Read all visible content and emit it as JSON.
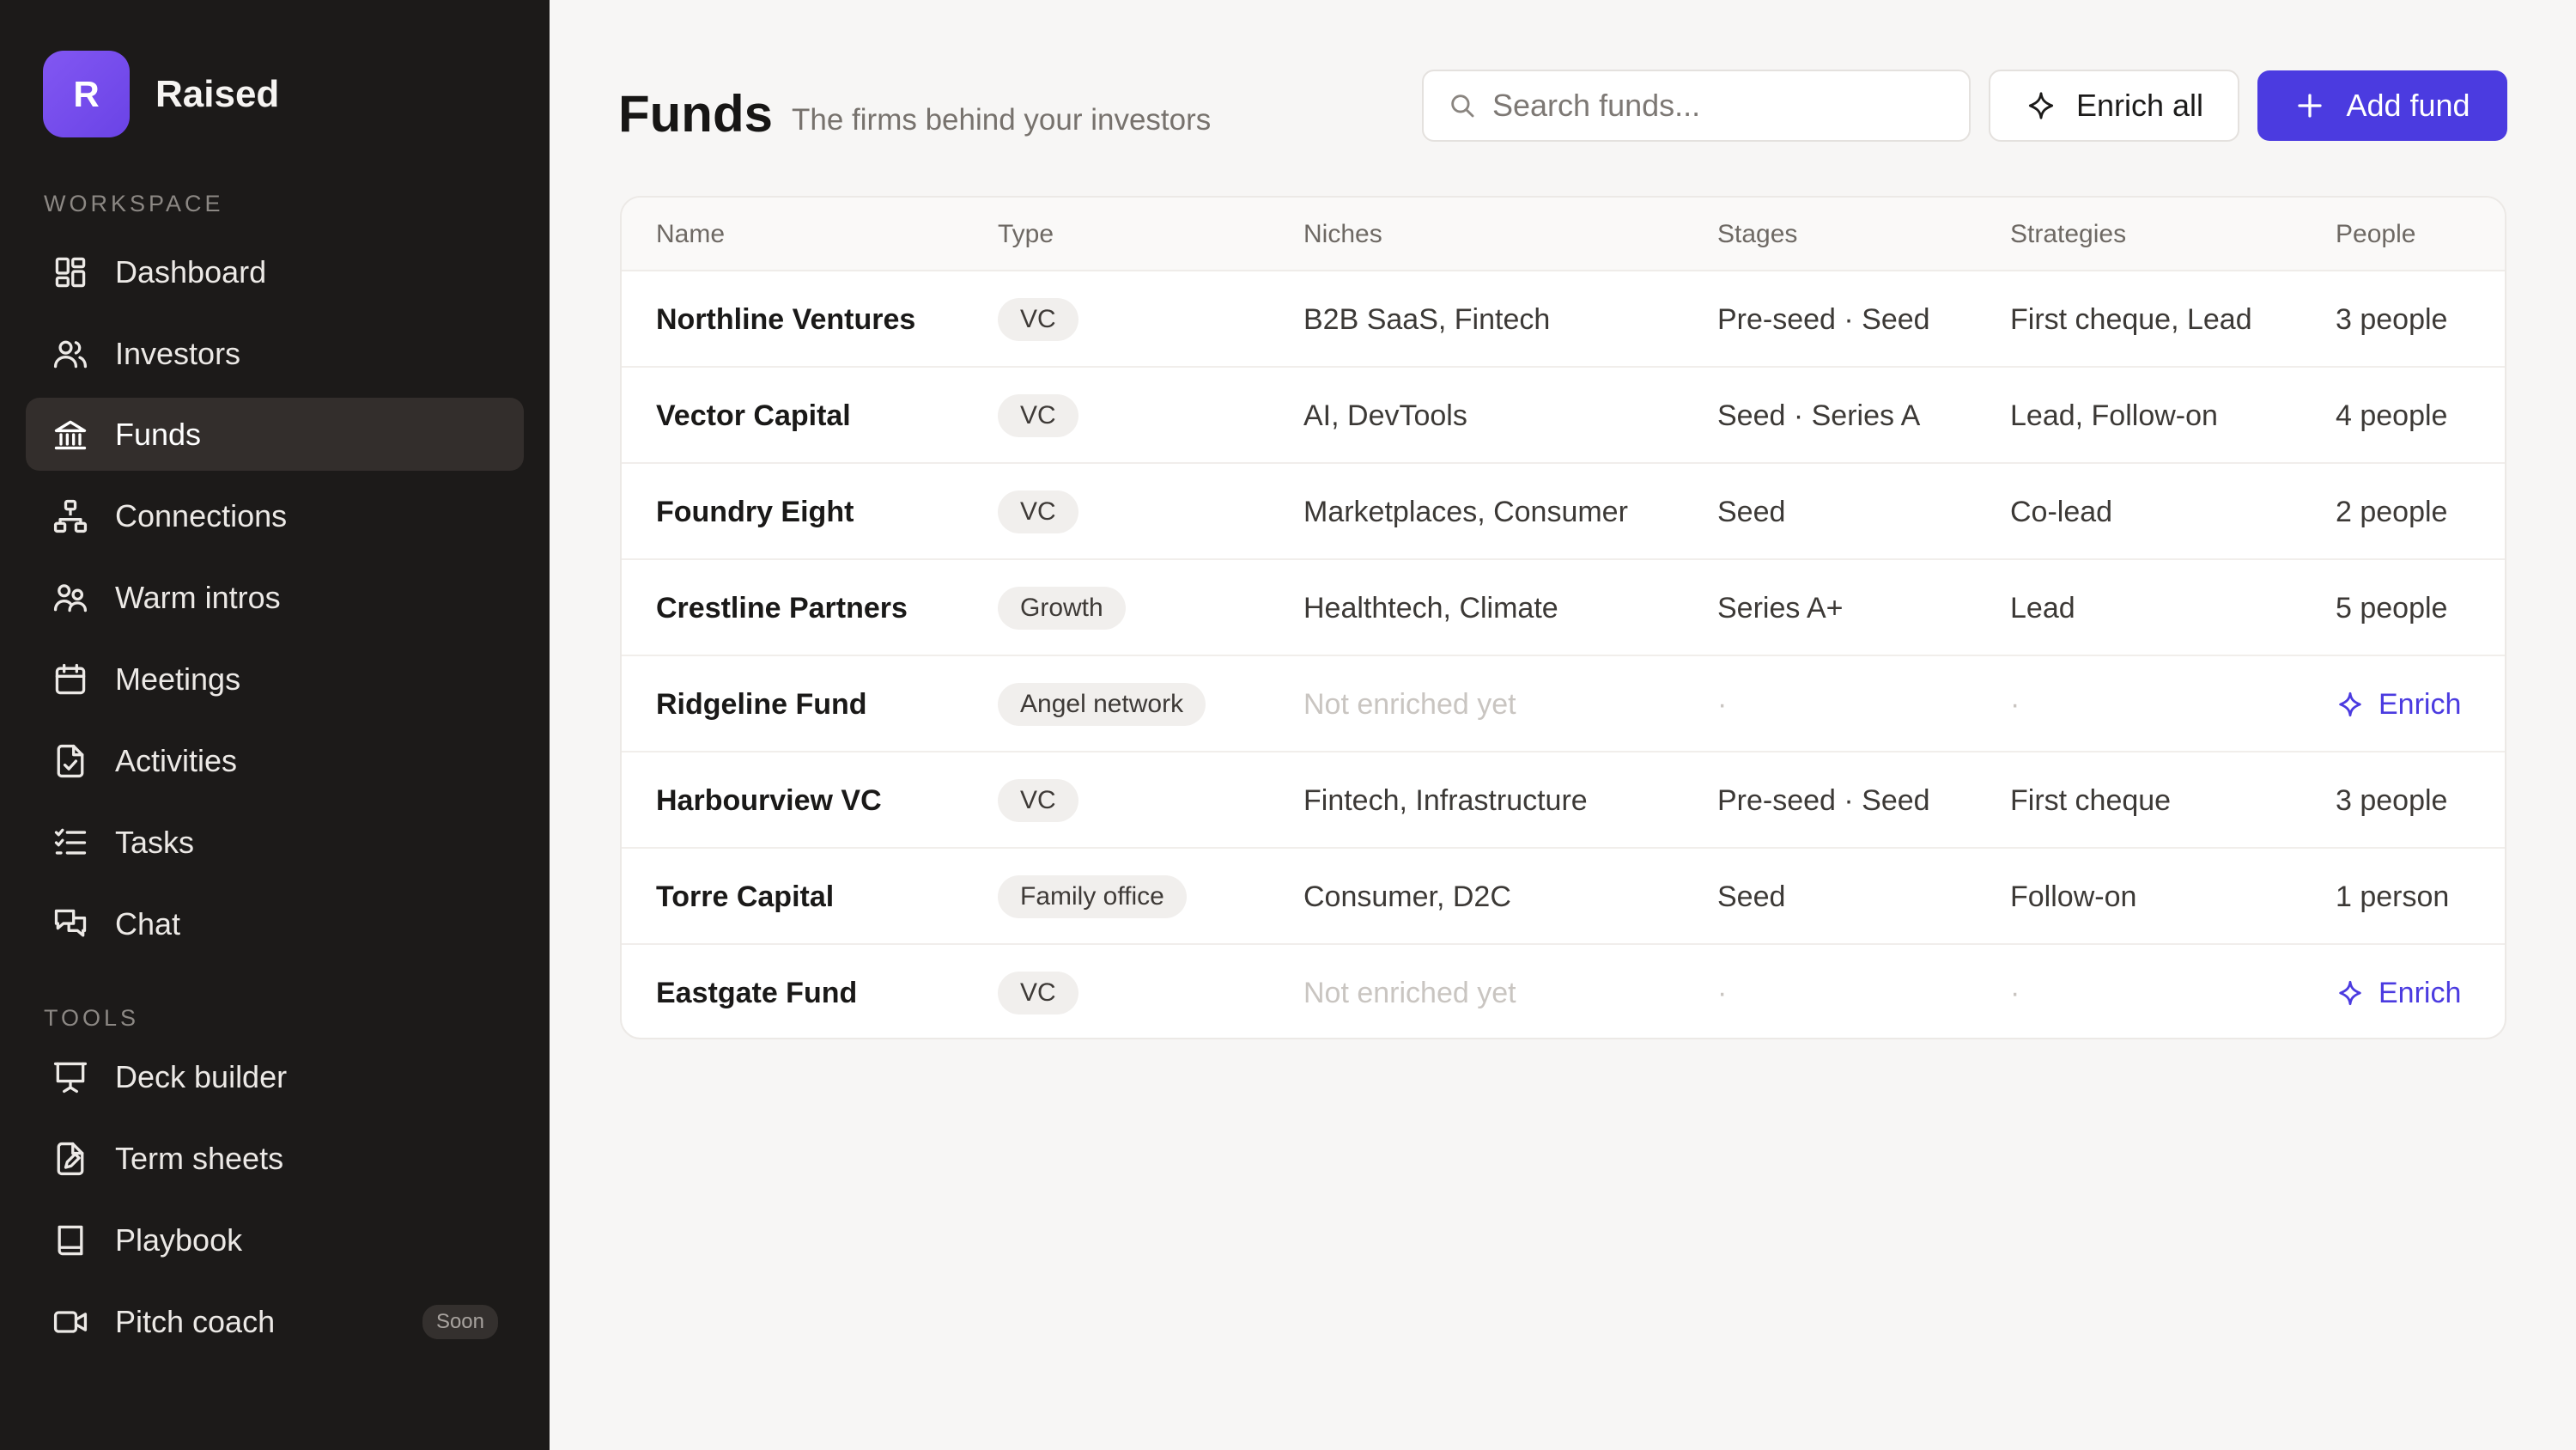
{
  "app": {
    "logo_letter": "R",
    "name": "Raised"
  },
  "sidebar": {
    "workspace_label": "WORKSPACE",
    "tools_label": "TOOLS",
    "workspace_items": [
      {
        "label": "Dashboard",
        "icon": "dashboard-icon",
        "active": false
      },
      {
        "label": "Investors",
        "icon": "users-icon",
        "active": false
      },
      {
        "label": "Funds",
        "icon": "bank-icon",
        "active": true
      },
      {
        "label": "Connections",
        "icon": "network-icon",
        "active": false
      },
      {
        "label": "Warm intros",
        "icon": "people-intro-icon",
        "active": false
      },
      {
        "label": "Meetings",
        "icon": "calendar-icon",
        "active": false
      },
      {
        "label": "Activities",
        "icon": "file-check-icon",
        "active": false
      },
      {
        "label": "Tasks",
        "icon": "checklist-icon",
        "active": false
      },
      {
        "label": "Chat",
        "icon": "chat-icon",
        "active": false
      }
    ],
    "tools_items": [
      {
        "label": "Deck builder",
        "icon": "presentation-icon"
      },
      {
        "label": "Term sheets",
        "icon": "document-edit-icon"
      },
      {
        "label": "Playbook",
        "icon": "book-icon"
      },
      {
        "label": "Pitch coach",
        "icon": "video-icon",
        "badge": "Soon"
      }
    ]
  },
  "header": {
    "title": "Funds",
    "subtitle": "The firms behind your investors",
    "search_placeholder": "Search funds...",
    "enrich_all_label": "Enrich all",
    "add_fund_label": "Add fund"
  },
  "table": {
    "columns": [
      "Name",
      "Type",
      "Niches",
      "Stages",
      "Strategies",
      "People"
    ],
    "rows": [
      {
        "name": "Northline Ventures",
        "type": "VC",
        "niches": "B2B SaaS, Fintech",
        "stages": "Pre-seed · Seed",
        "strategies": "First cheque, Lead",
        "people": "3 people",
        "enriched": true
      },
      {
        "name": "Vector Capital",
        "type": "VC",
        "niches": "AI, DevTools",
        "stages": "Seed · Series A",
        "strategies": "Lead, Follow-on",
        "people": "4 people",
        "enriched": true
      },
      {
        "name": "Foundry Eight",
        "type": "VC",
        "niches": "Marketplaces, Consumer",
        "stages": "Seed",
        "strategies": "Co-lead",
        "people": "2 people",
        "enriched": true
      },
      {
        "name": "Crestline Partners",
        "type": "Growth",
        "niches": "Healthtech, Climate",
        "stages": "Series A+",
        "strategies": "Lead",
        "people": "5 people",
        "enriched": true
      },
      {
        "name": "Ridgeline Fund",
        "type": "Angel network",
        "niches": "Not enriched yet",
        "stages": "·",
        "strategies": "·",
        "people": "Enrich",
        "enriched": false
      },
      {
        "name": "Harbourview VC",
        "type": "VC",
        "niches": "Fintech, Infrastructure",
        "stages": "Pre-seed · Seed",
        "strategies": "First cheque",
        "people": "3 people",
        "enriched": true
      },
      {
        "name": "Torre Capital",
        "type": "Family office",
        "niches": "Consumer, D2C",
        "stages": "Seed",
        "strategies": "Follow-on",
        "people": "1 person",
        "enriched": true
      },
      {
        "name": "Eastgate Fund",
        "type": "VC",
        "niches": "Not enriched yet",
        "stages": "·",
        "strategies": "·",
        "people": "Enrich",
        "enriched": false
      }
    ]
  },
  "colors": {
    "sidebar_bg": "#1c1a19",
    "accent": "#4b3be0",
    "logo_gradient_start": "#8257f2"
  }
}
